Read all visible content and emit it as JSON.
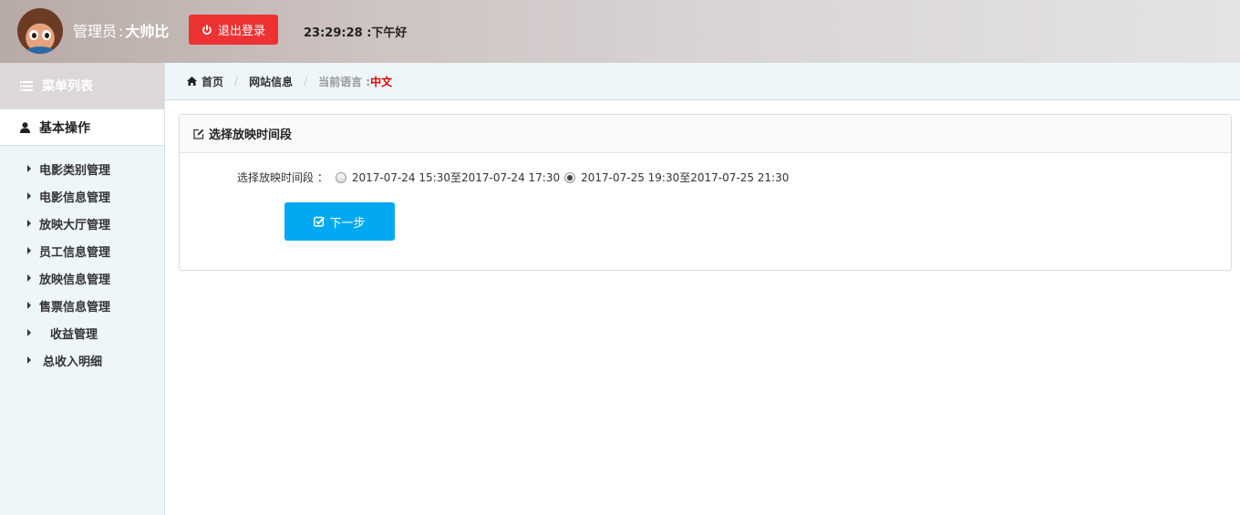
{
  "header": {
    "admin_prefix": "管理员",
    "admin_sep": ":",
    "admin_name": "大帅比",
    "logout_label": "退出登录",
    "time": "23:29:28",
    "time_sep": ":",
    "greeting": "下午好"
  },
  "sidebar": {
    "menu_title": "菜单列表",
    "group_title": "基本操作",
    "items": [
      {
        "label": "电影类别管理"
      },
      {
        "label": "电影信息管理"
      },
      {
        "label": "放映大厅管理"
      },
      {
        "label": "员工信息管理"
      },
      {
        "label": "放映信息管理"
      },
      {
        "label": "售票信息管理"
      },
      {
        "label": "收益管理"
      },
      {
        "label": "总收入明细"
      }
    ]
  },
  "breadcrumb": {
    "home": "首页",
    "site_info": "网站信息",
    "lang_label": "当前语言 :",
    "lang_value": "中文"
  },
  "panel": {
    "title": "选择放映时间段",
    "field_label": "选择放映时间段 ：",
    "options": [
      {
        "text": "2017-07-24 15:30至2017-07-24 17:30",
        "checked": false
      },
      {
        "text": "2017-07-25 19:30至2017-07-25 21:30",
        "checked": true
      }
    ],
    "next_label": "下一步"
  },
  "colors": {
    "logout": "#ec3232",
    "next": "#03a9f0",
    "lang_value": "#dd0000",
    "sidebar_bg": "#eef6fa"
  }
}
